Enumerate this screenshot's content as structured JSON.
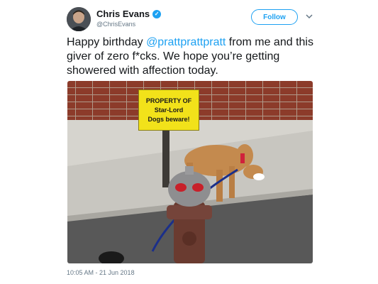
{
  "user": {
    "name": "Chris Evans",
    "handle": "@ChrisEvans",
    "verified": true,
    "avatar_icon": "avatar-photo"
  },
  "actions": {
    "follow_label": "Follow",
    "more_icon": "chevron-down-icon"
  },
  "tweet": {
    "text_before": "Happy birthday ",
    "mention": "@prattprattpratt",
    "text_after": " from me and this giver of zero f*cks. We hope you’re getting showered with affection today."
  },
  "media": {
    "sign": {
      "line1": "PROPERTY OF",
      "line2": "Star-Lord",
      "line3": "Dogs beware!"
    }
  },
  "timestamp": "10:05 AM - 21 Jun 2018",
  "colors": {
    "accent": "#1da1f2",
    "secondary_text": "#657786",
    "primary_text": "#14171a"
  }
}
